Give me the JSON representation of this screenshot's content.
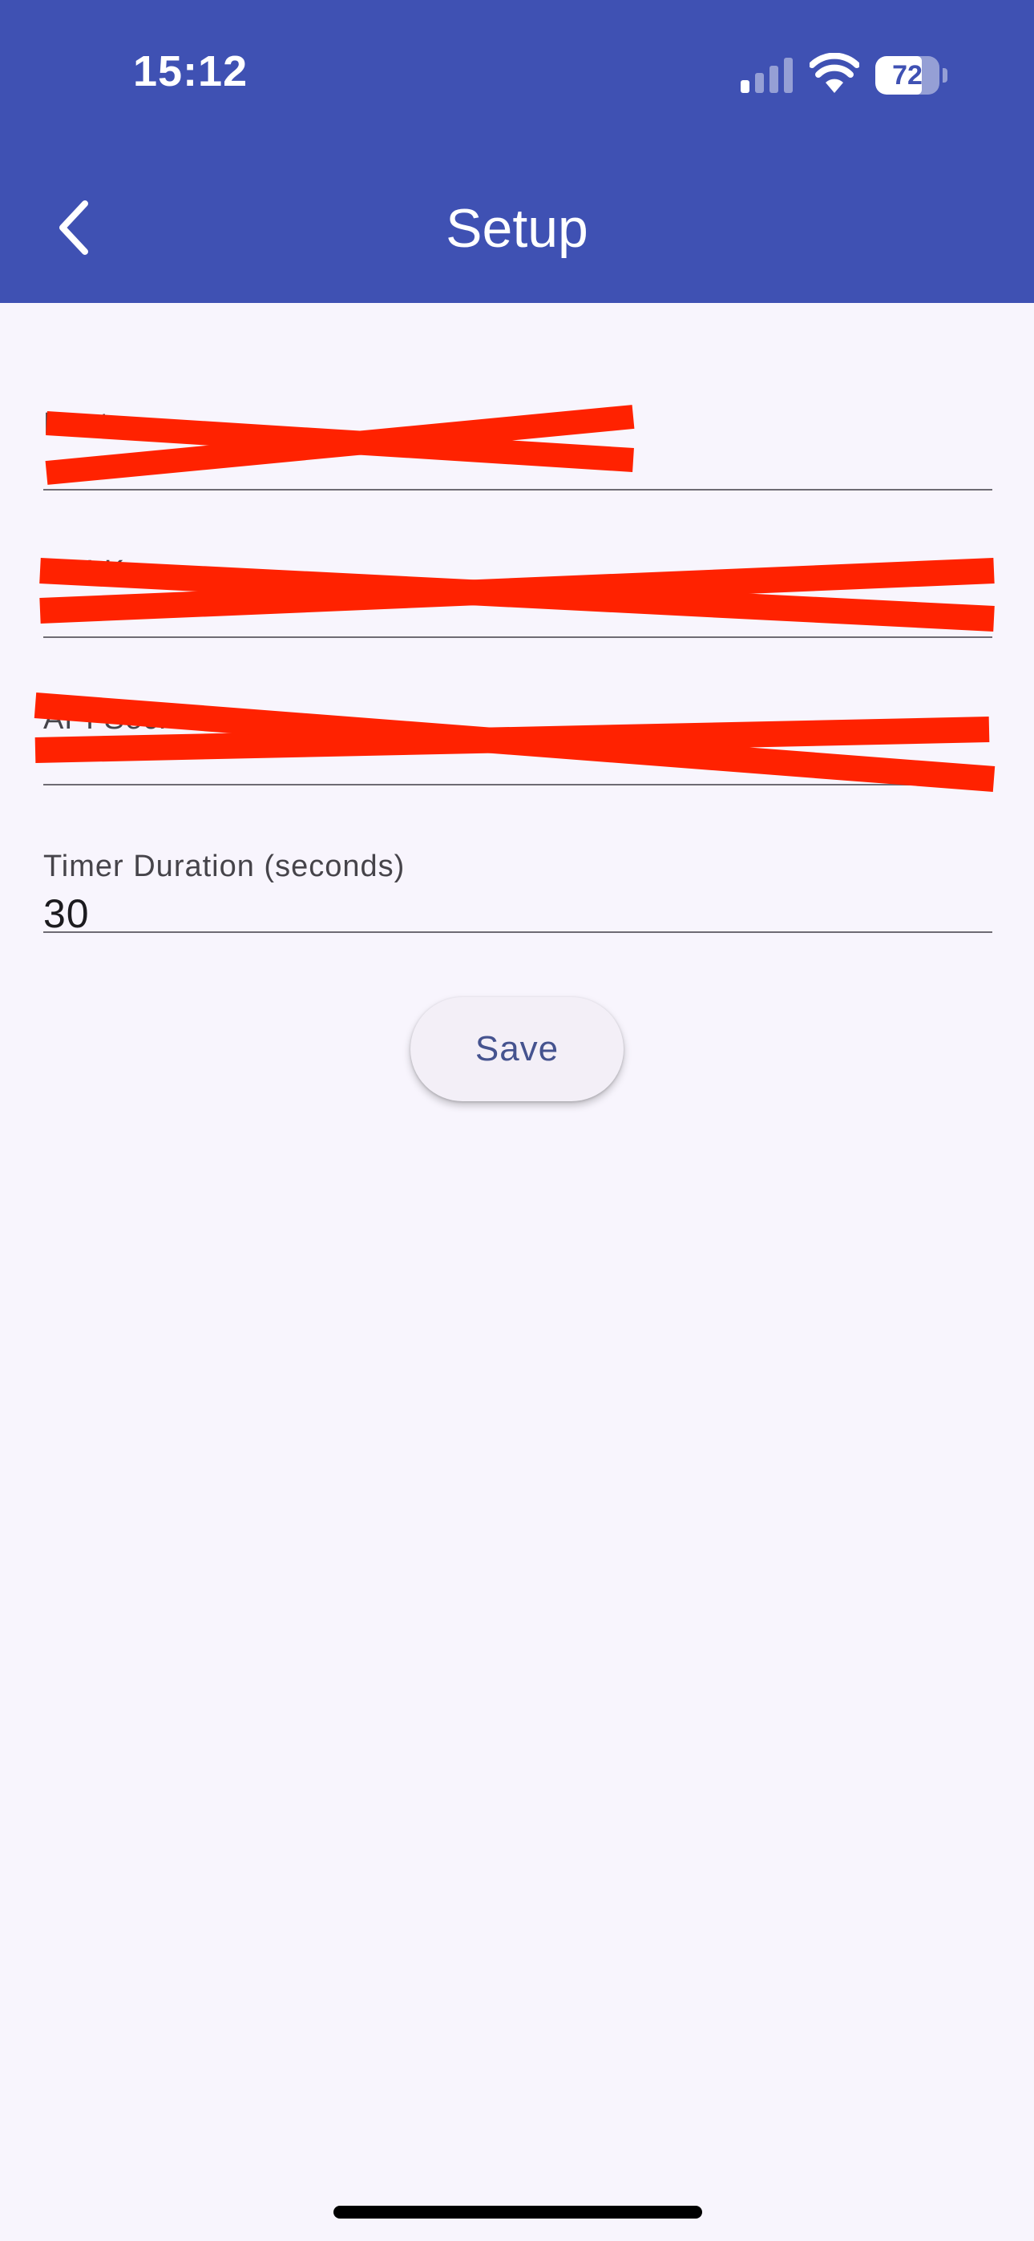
{
  "status_bar": {
    "time": "15:12",
    "battery_level": "72",
    "battery_fraction": 0.72,
    "signal_icon": "cellular-signal-icon",
    "wifi_icon": "wifi-icon"
  },
  "header": {
    "title": "Setup",
    "back_icon": "chevron-left-icon",
    "background_color": "#3f51b3"
  },
  "form": {
    "fields": [
      {
        "label": "Host",
        "value": ""
      },
      {
        "label": "API Key",
        "value": ""
      },
      {
        "label": "API Secret",
        "value": ""
      },
      {
        "label": "Timer Duration (seconds)",
        "value": "30"
      }
    ],
    "redaction_color": "#ff2200"
  },
  "actions": {
    "save_label": "Save"
  }
}
